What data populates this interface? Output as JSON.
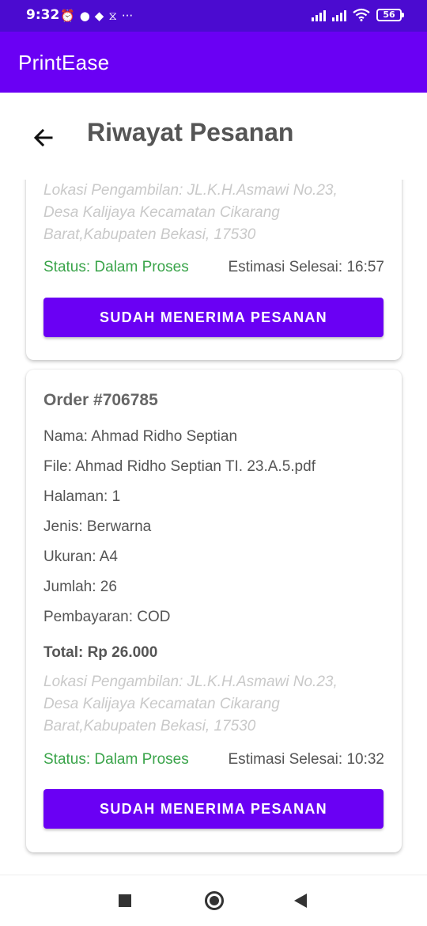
{
  "status_bar": {
    "time": "9:32",
    "left_icons": [
      "alarm-icon",
      "chat-icon",
      "dropbox-icon",
      "sync-icon",
      "more-icon"
    ],
    "left_glyphs": [
      "⏰",
      "●",
      "◆",
      "⧖",
      "···"
    ],
    "battery": "56"
  },
  "app_bar": {
    "title": "PrintEase"
  },
  "page": {
    "title": "Riwayat Pesanan"
  },
  "orders": [
    {
      "lokasi": "Lokasi Pengambilan: JL.K.H.Asmawi No.23, Desa Kalijaya Kecamatan Cikarang Barat,Kabupaten Bekasi, 17530",
      "status": "Status: Dalam Proses",
      "estimasi": "Estimasi Selesai: 16:57",
      "button_label": "SUDAH MENERIMA PESANAN"
    },
    {
      "order_no": "Order #706785",
      "nama": "Nama: Ahmad Ridho Septian",
      "file": "File: Ahmad Ridho Septian TI. 23.A.5.pdf",
      "halaman": "Halaman: 1",
      "jenis": "Jenis: Berwarna",
      "ukuran": "Ukuran: A4",
      "jumlah": "Jumlah: 26",
      "pembayaran": "Pembayaran:  COD",
      "total": "Total: Rp 26.000",
      "lokasi": "Lokasi Pengambilan: JL.K.H.Asmawi No.23, Desa Kalijaya Kecamatan Cikarang Barat,Kabupaten Bekasi, 17530",
      "status": "Status: Dalam Proses",
      "estimasi": "Estimasi Selesai: 10:32",
      "button_label": "SUDAH MENERIMA PESANAN"
    }
  ],
  "colors": {
    "status_bar": "#4b0bd0",
    "app_bar": "#6a00f4",
    "button": "#6a00f4",
    "status_text": "#3aa44a",
    "lokasi_text": "#c9c9c9"
  },
  "nav_bar": {
    "icons": [
      "recents-square-icon",
      "home-circle-icon",
      "back-triangle-icon"
    ]
  }
}
